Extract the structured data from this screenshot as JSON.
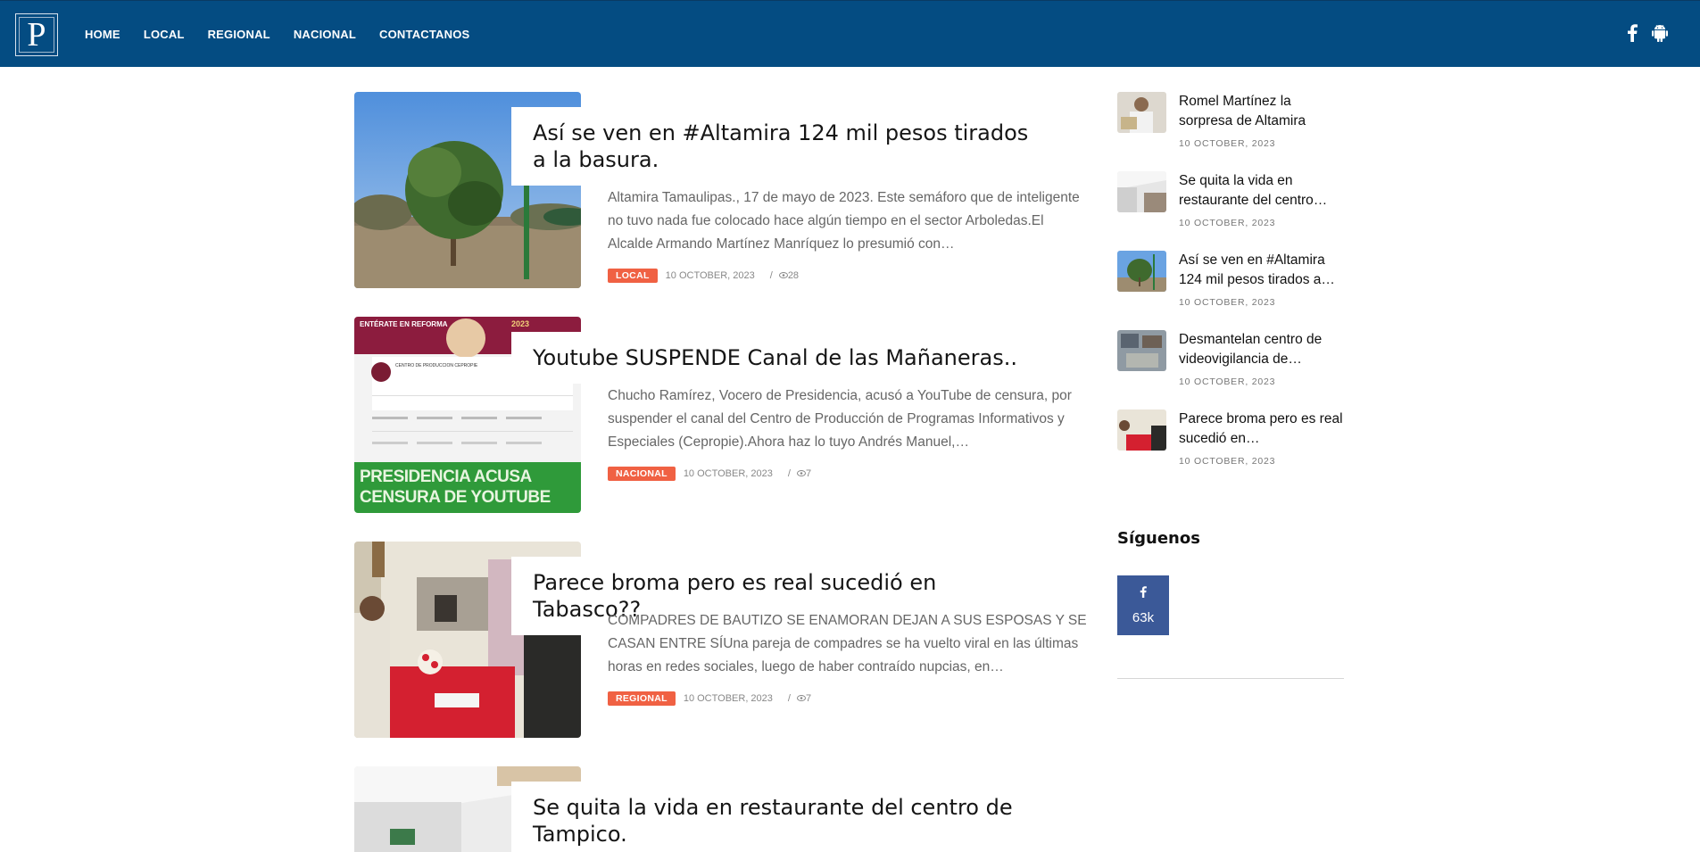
{
  "nav": {
    "logo": "P",
    "items": [
      "HOME",
      "LOCAL",
      "REGIONAL",
      "NACIONAL",
      "CONTACTANOS"
    ],
    "social": [
      "facebook-icon",
      "android-icon"
    ]
  },
  "posts": [
    {
      "title": "Así se ven en #Altamira 124 mil pesos tirados a la basura.",
      "excerpt": "Altamira Tamaulipas., 17 de mayo de 2023. Este semáforo que de inteligente no tuvo nada fue colocado hace algún tiempo en el sector Arboledas.El Alcalde Armando Martínez Manríquez lo presumió con…",
      "category": "LOCAL",
      "date": "10 OCTOBER, 2023",
      "views": "28"
    },
    {
      "title": "Youtube SUSPENDE Canal de las Mañaneras..",
      "excerpt": "Chucho Ramírez, Vocero de Presidencia, acusó a YouTube de censura, por suspender el canal del Centro de Producción de Programas Informativos y Especiales (Cepropie).Ahora haz lo tuyo Andrés Manuel,…",
      "category": "NACIONAL",
      "date": "10 OCTOBER, 2023",
      "views": "7",
      "thumb_text": {
        "top_left": "ENTÉRATE EN REFORMA",
        "year": "2023",
        "line1": "PRESIDENCIA ACUSA",
        "line2": "CENSURA DE YOUTUBE",
        "channel": "CENTRO DE PRODUCCION CEPROPIE"
      }
    },
    {
      "title": "Parece broma pero es real sucedió en Tabasco??",
      "excerpt": "COMPADRES DE BAUTIZO SE ENAMORAN DEJAN A SUS ESPOSAS Y SE CASAN ENTRE SÍUna pareja de compadres se ha vuelto viral en las últimas horas en redes sociales, luego de haber contraído nupcias, en…",
      "category": "REGIONAL",
      "date": "10 OCTOBER, 2023",
      "views": "7"
    },
    {
      "title": "Se quita la vida en restaurante del centro de Tampico.",
      "excerpt": "",
      "category": "",
      "date": "",
      "views": ""
    }
  ],
  "sidebar": {
    "recent": [
      {
        "title": "Romel Martínez la sorpresa de Altamira",
        "date": "10 OCTOBER, 2023"
      },
      {
        "title": "Se quita la vida en restaurante del centro…",
        "date": "10 OCTOBER, 2023"
      },
      {
        "title": "Así se ven en #Altamira 124 mil pesos tirados a…",
        "date": "10 OCTOBER, 2023"
      },
      {
        "title": "Desmantelan centro de videovigilancia de…",
        "date": "10 OCTOBER, 2023"
      },
      {
        "title": "Parece broma pero es real sucedió en…",
        "date": "10 OCTOBER, 2023"
      }
    ],
    "follow_heading": "Síguenos",
    "facebook_count": "63k"
  },
  "colors": {
    "navbar": "#044c82",
    "category_badge": "#f06143",
    "facebook": "#3b5998"
  }
}
